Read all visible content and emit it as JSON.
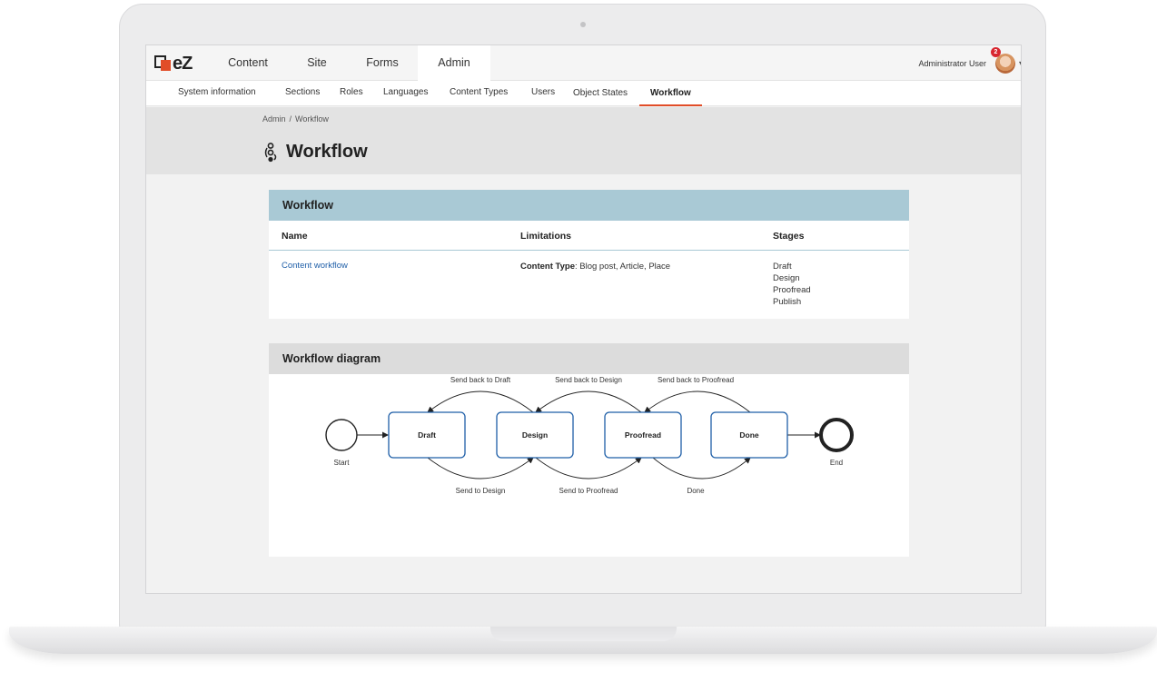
{
  "logo": {
    "text": "eZ"
  },
  "main_tabs": [
    {
      "label": "Content",
      "active": false
    },
    {
      "label": "Site",
      "active": false
    },
    {
      "label": "Forms",
      "active": false
    },
    {
      "label": "Admin",
      "active": true
    }
  ],
  "user": {
    "name": "Administrator User",
    "notifications": "2"
  },
  "subnav": [
    {
      "label": "System information",
      "active": false
    },
    {
      "label": "Sections",
      "active": false
    },
    {
      "label": "Roles",
      "active": false
    },
    {
      "label": "Languages",
      "active": false
    },
    {
      "label": "Content Types",
      "active": false
    },
    {
      "label": "Users",
      "active": false
    },
    {
      "label": "Object States",
      "active": false
    },
    {
      "label": "Workflow",
      "active": true
    }
  ],
  "breadcrumb": {
    "items": [
      "Admin",
      "Workflow"
    ],
    "separator": "/"
  },
  "page_title": "Workflow",
  "workflow_table": {
    "title": "Workflow",
    "columns": [
      "Name",
      "Limitations",
      "Stages"
    ],
    "row": {
      "name": "Content workflow",
      "limitation_label": "Content Type",
      "limitation_value": ": Blog post, Article, Place",
      "stages": [
        "Draft",
        "Design",
        "Proofread",
        "Publish"
      ]
    }
  },
  "diagram": {
    "title": "Workflow diagram",
    "start_label": "Start",
    "end_label": "End",
    "nodes": [
      "Draft",
      "Design",
      "Proofread",
      "Done"
    ],
    "forward_transitions": [
      "Send to Design",
      "Send to Proofread",
      "Done"
    ],
    "back_transitions": [
      "Send back to Draft",
      "Send back to Design",
      "Send back to Proofread"
    ]
  },
  "colors": {
    "accent": "#e14d28",
    "table_header": "#a9c9d5",
    "link": "#1f5fa8",
    "node_border": "#1f5fa8"
  }
}
